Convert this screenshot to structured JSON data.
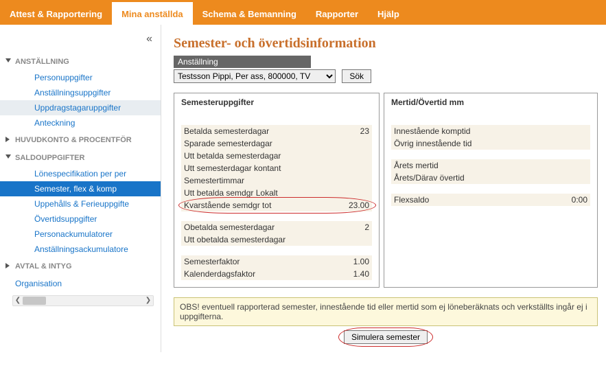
{
  "topnav": {
    "tabs": [
      {
        "label": "Attest & Rapportering"
      },
      {
        "label": "Mina anställda"
      },
      {
        "label": "Schema & Bemanning"
      },
      {
        "label": "Rapporter"
      },
      {
        "label": "Hjälp"
      }
    ],
    "active_index": 1
  },
  "sidebar": {
    "collapse_glyph": "«",
    "groups": [
      {
        "label": "ANSTÄLLNING",
        "expanded": true,
        "items": [
          {
            "label": "Personuppgifter"
          },
          {
            "label": "Anställningsuppgifter"
          },
          {
            "label": "Uppdragstagaruppgifter",
            "highlight": true
          },
          {
            "label": "Anteckning"
          }
        ]
      },
      {
        "label": "HUVUDKONTO & PROCENTFÖR",
        "expanded": false,
        "items": []
      },
      {
        "label": "SALDOUPPGIFTER",
        "expanded": true,
        "items": [
          {
            "label": "Lönespecifikation per per"
          },
          {
            "label": "Semester, flex & komp",
            "selected": true
          },
          {
            "label": "Uppehålls & Ferieuppgifte"
          },
          {
            "label": "Övertidsuppgifter"
          },
          {
            "label": "Personackumulatorer"
          },
          {
            "label": "Anställningsackumulatore"
          }
        ]
      },
      {
        "label": "AVTAL & INTYG",
        "expanded": false,
        "items": []
      }
    ],
    "bottom_link": "Organisation"
  },
  "page": {
    "title": "Semester- och övertidsinformation",
    "section_label": "Anställning",
    "employee_select_value": "Testsson Pippi, Per ass, 800000, TV",
    "search_button": "Sök"
  },
  "panel_left": {
    "title": "Semesteruppgifter",
    "rows_a": [
      {
        "label": "Betalda semesterdagar",
        "val": "23"
      },
      {
        "label": "Sparade semesterdagar",
        "val": ""
      },
      {
        "label": "Utt betalda semesterdagar",
        "val": ""
      },
      {
        "label": "Utt semesterdagar kontant",
        "val": ""
      },
      {
        "label": "Semestertimmar",
        "val": ""
      },
      {
        "label": "Utt betalda semdgr Lokalt",
        "val": ""
      },
      {
        "label": "Kvarstående semdgr tot",
        "val": "23.00",
        "circled": true
      }
    ],
    "rows_b": [
      {
        "label": "Obetalda semesterdagar",
        "val": "2"
      },
      {
        "label": "Utt obetalda semesterdagar",
        "val": ""
      }
    ],
    "rows_c": [
      {
        "label": "Semesterfaktor",
        "val": "1.00"
      },
      {
        "label": "Kalenderdagsfaktor",
        "val": "1.40"
      }
    ]
  },
  "panel_right": {
    "title": "Mertid/Övertid mm",
    "rows_a": [
      {
        "label": "Innestående komptid",
        "val": ""
      },
      {
        "label": "Övrig innestående tid",
        "val": ""
      }
    ],
    "rows_b": [
      {
        "label": "Årets mertid",
        "val": ""
      },
      {
        "label": "Årets/Därav övertid",
        "val": ""
      }
    ],
    "rows_c": [
      {
        "label": "Flexsaldo",
        "val": "0:00"
      }
    ]
  },
  "note": "OBS! eventuell rapporterad semester, innestående tid eller mertid som ej löneberäknats och verkställts ingår ej i uppgifterna.",
  "simulate_button": "Simulera semester"
}
